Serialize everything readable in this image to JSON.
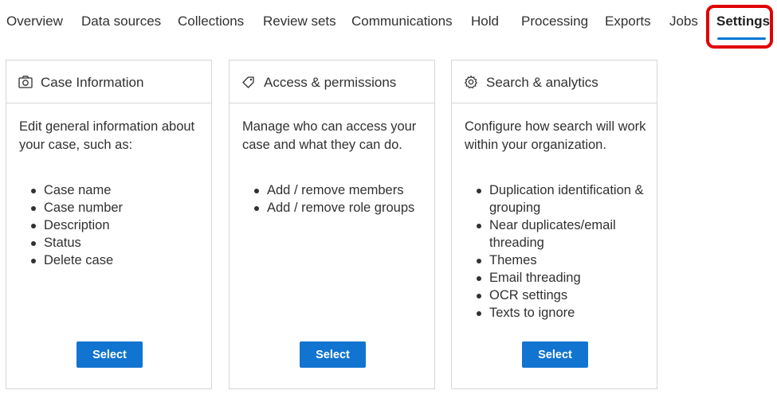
{
  "nav": {
    "tabs": [
      {
        "label": "Overview"
      },
      {
        "label": "Data sources"
      },
      {
        "label": "Collections"
      },
      {
        "label": "Review sets"
      },
      {
        "label": "Communications"
      },
      {
        "label": "Hold"
      },
      {
        "label": "Processing"
      },
      {
        "label": "Exports"
      },
      {
        "label": "Jobs"
      },
      {
        "label": "Settings",
        "active": true
      }
    ]
  },
  "cards": [
    {
      "icon": "camera-icon",
      "title": "Case Information",
      "description": "Edit general information about your case, such as:",
      "items": [
        "Case name",
        "Case number",
        "Description",
        "Status",
        "Delete case"
      ],
      "button": "Select"
    },
    {
      "icon": "tag-icon",
      "title": "Access & permissions",
      "description": "Manage who can access your case and what they can do.",
      "items": [
        "Add / remove members",
        "Add / remove role groups"
      ],
      "button": "Select"
    },
    {
      "icon": "gear-icon",
      "title": "Search & analytics",
      "description": "Configure how search will work within your organization.",
      "items": [
        "Duplication identification & grouping",
        "Near duplicates/email threading",
        "Themes",
        "Email threading",
        "OCR settings",
        "Texts to ignore"
      ],
      "button": "Select"
    }
  ],
  "colors": {
    "accent": "#0078d4",
    "button": "#1174d0",
    "highlight": "#e00000"
  }
}
